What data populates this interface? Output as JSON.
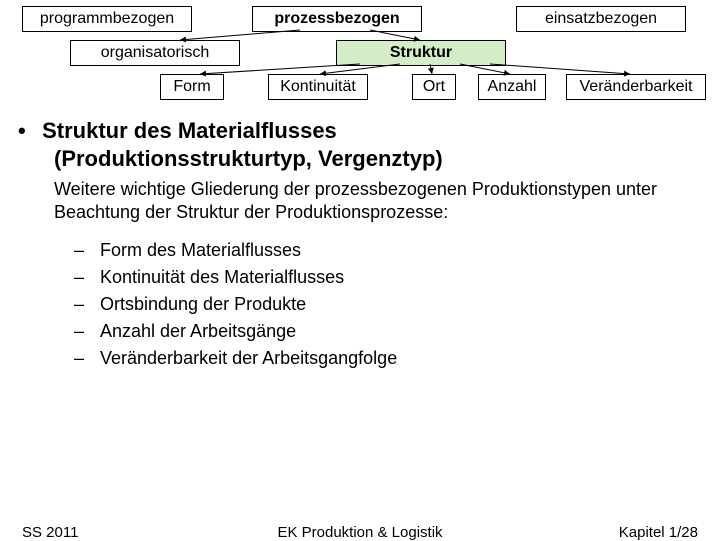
{
  "diagram": {
    "row1": {
      "a": "programmbezogen",
      "b": "prozessbezogen",
      "c": "einsatzbezogen"
    },
    "row2": {
      "a": "organisatorisch",
      "b": "Struktur"
    },
    "row3": {
      "a": "Form",
      "b": "Kontinuität",
      "c": "Ort",
      "d": "Anzahl",
      "e": "Veränderbarkeit"
    }
  },
  "heading": {
    "bullet": "•",
    "line1": "Struktur des Materialflusses",
    "line2": "(Produktionsstrukturtyp, Vergenztyp)"
  },
  "paragraph": "Weitere wichtige Gliederung der prozessbezogenen Produktionstypen unter Beachtung der Struktur der Produktionsprozesse:",
  "list": [
    "Form des Materialflusses",
    "Kontinuität des Materialflusses",
    "Ortsbindung der Produkte",
    "Anzahl der Arbeitsgänge",
    "Veränderbarkeit der Arbeitsgangfolge"
  ],
  "footer": {
    "left": "SS 2011",
    "center": "EK Produktion & Logistik",
    "right": "Kapitel 1/28"
  }
}
